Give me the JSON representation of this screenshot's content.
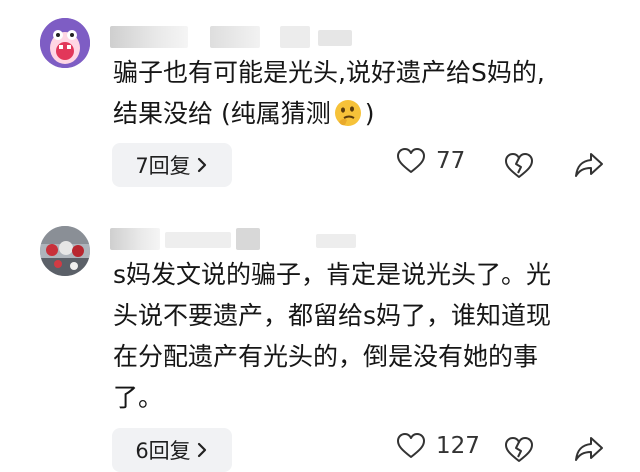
{
  "comments": [
    {
      "avatar_icon": "purple-cartoon-avatar-icon",
      "text": "骗子也有可能是光头,说好遗产给S妈的,\n结果没给 (纯属猜测",
      "text_suffix": ")",
      "emoji": "thinking-face-emoji-icon",
      "reply_label": "7回复",
      "like_count": "77"
    },
    {
      "avatar_icon": "photo-avatar-icon",
      "text": "s妈发文说的骗子，肯定是说光头了。光\n头说不要遗产，都留给s妈了，谁知道现\n在分配遗产有光头的，倒是没有她的事\n了。",
      "reply_label": "6回复",
      "like_count": "127"
    }
  ],
  "icons": {
    "like": "heart-outline-icon",
    "dislike": "broken-heart-icon",
    "share": "share-arrow-icon",
    "chevron": "chevron-right-icon"
  }
}
